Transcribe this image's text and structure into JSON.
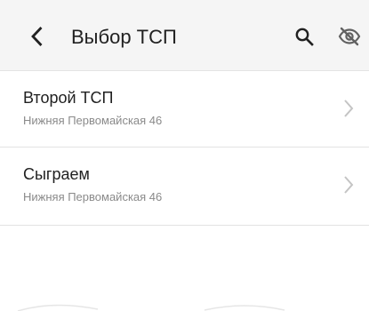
{
  "header": {
    "title": "Выбор ТСП",
    "back_icon": "chevron-left-icon",
    "search_icon": "search-icon",
    "visibility_icon": "eye-off-icon"
  },
  "list": {
    "items": [
      {
        "title": "Второй ТСП",
        "address": "Нижняя Первомайская 46"
      },
      {
        "title": "Сыграем",
        "address": "Нижняя Первомайская 46"
      }
    ]
  },
  "colors": {
    "app_bar_bg": "#f5f5f5",
    "text_primary": "#212121",
    "text_secondary": "#8a8a8a",
    "divider": "#e3e3e3",
    "chevron": "#c4c4c4"
  }
}
